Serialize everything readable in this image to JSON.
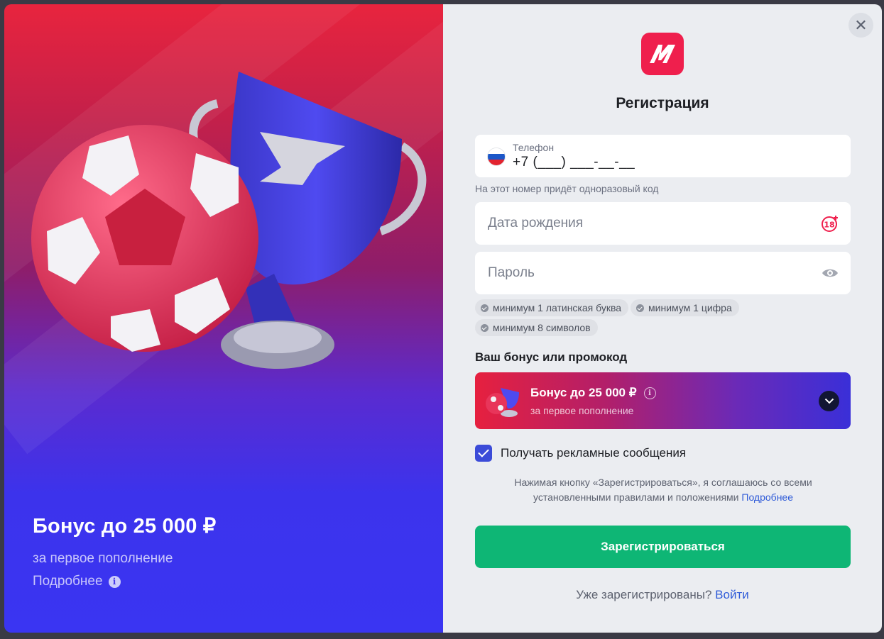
{
  "promo": {
    "title": "Бонус до 25 000 ₽",
    "subtitle": "за первое пополнение",
    "more_link": "Подробнее",
    "info_glyph": "i"
  },
  "form": {
    "close_glyph": "✕",
    "title": "Регистрация",
    "phone": {
      "label": "Телефон",
      "value": "+7 (___) ___-__-__",
      "hint": "На этот номер придёт одноразовый код"
    },
    "dob": {
      "placeholder": "Дата рождения",
      "icon": "age-18-plus-icon"
    },
    "password": {
      "placeholder": "Пароль",
      "icon": "eye-icon"
    },
    "password_rules": [
      "минимум 1 латинская буква",
      "минимум 1 цифра",
      "минимум 8 символов"
    ],
    "bonus_heading": "Ваш бонус или промокод",
    "bonus_card": {
      "title": "Бонус до 25 000 ₽",
      "subtitle": "за первое пополнение",
      "info_glyph": "i"
    },
    "consent": {
      "label": "Получать рекламные сообщения",
      "checked": true
    },
    "terms": {
      "text": "Нажимая кнопку «Зарегистрироваться», я соглашаюсь со всеми установленными правилами и положениями",
      "link": "Подробнее"
    },
    "submit_label": "Зарегистрироваться",
    "login": {
      "question": "Уже зарегистрированы?",
      "link": "Войти"
    }
  },
  "colors": {
    "brand": "#ef1f4d",
    "submit": "#0eb675",
    "link": "#2f5bd8",
    "checkbox": "#3b4bd8"
  }
}
